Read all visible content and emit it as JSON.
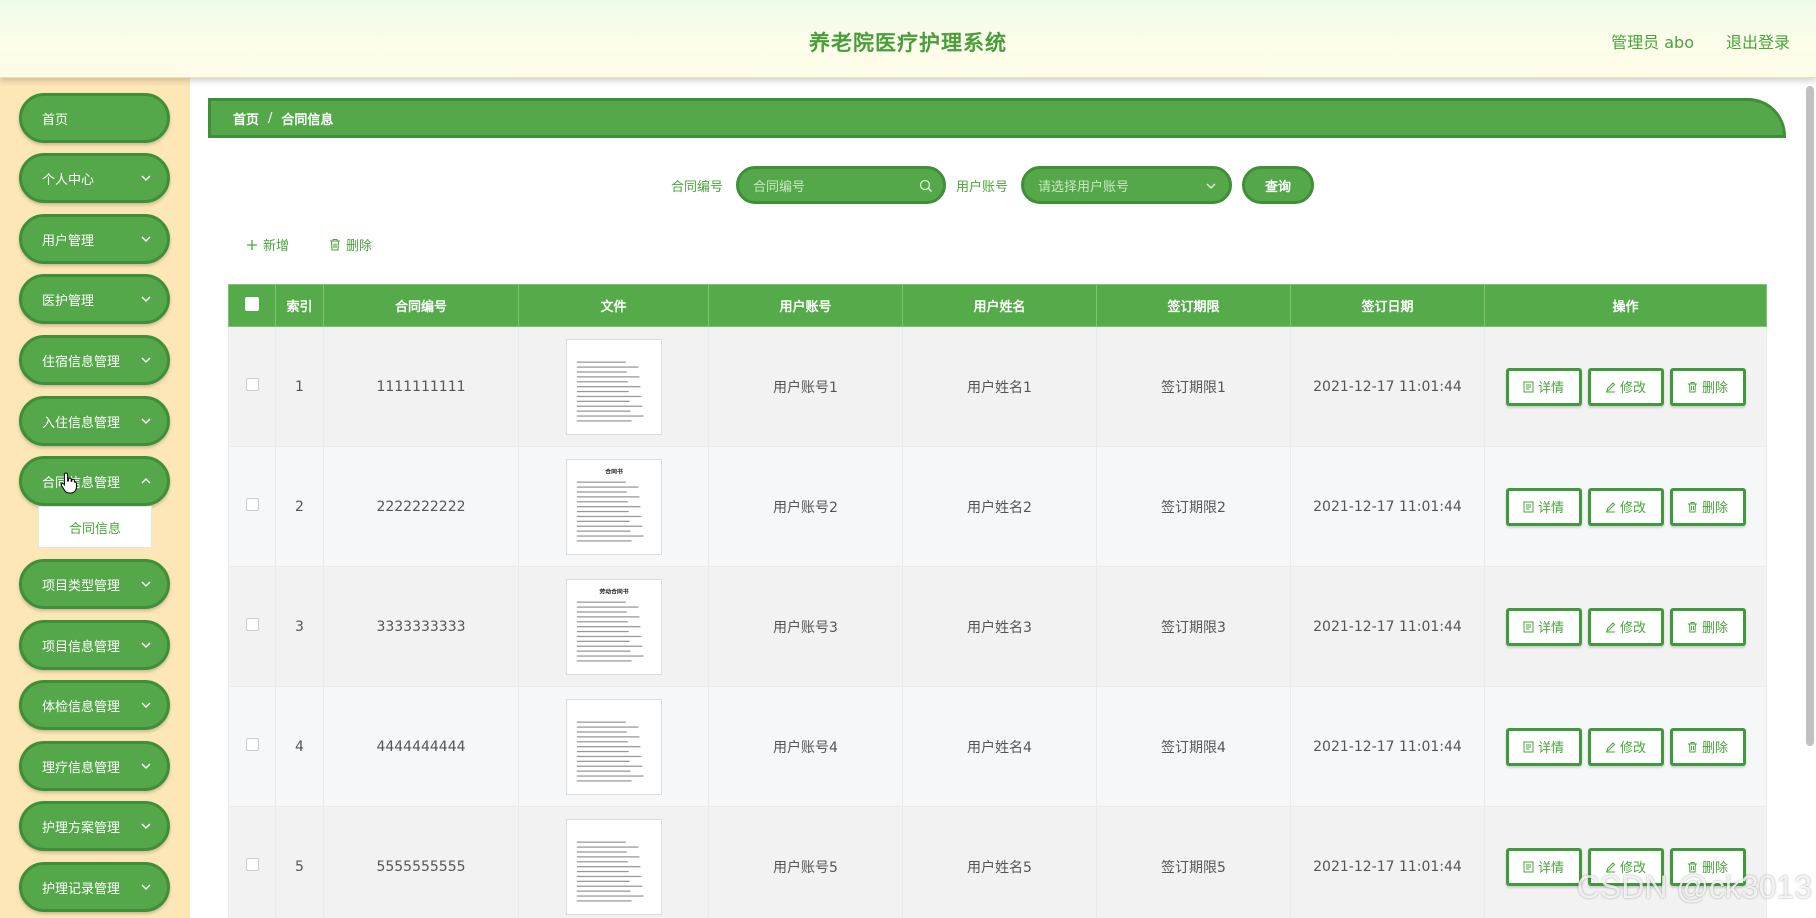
{
  "header": {
    "title": "养老院医疗护理系统",
    "user": "管理员 abo",
    "logout": "退出登录"
  },
  "sidebar": {
    "items": [
      {
        "label": "首页"
      },
      {
        "label": "个人中心"
      },
      {
        "label": "用户管理"
      },
      {
        "label": "医护管理"
      },
      {
        "label": "住宿信息管理"
      },
      {
        "label": "入住信息管理"
      },
      {
        "label": "合同信息管理"
      },
      {
        "label": "项目类型管理"
      },
      {
        "label": "项目信息管理"
      },
      {
        "label": "体检信息管理"
      },
      {
        "label": "理疗信息管理"
      },
      {
        "label": "护理方案管理"
      },
      {
        "label": "护理记录管理"
      }
    ],
    "submenu_label": "合同信息"
  },
  "breadcrumb": {
    "home": "首页",
    "separator": "/",
    "current": "合同信息"
  },
  "search": {
    "contract_label": "合同编号",
    "contract_placeholder": "合同编号",
    "account_label": "用户账号",
    "account_placeholder": "请选择用户账号",
    "button": "查询"
  },
  "toolbar": {
    "add": "新增",
    "delete": "删除"
  },
  "table": {
    "headers": {
      "index": "索引",
      "contract_no": "合同编号",
      "file": "文件",
      "account": "用户账号",
      "name": "用户姓名",
      "term": "签订期限",
      "date": "签订日期",
      "ops": "操作"
    },
    "rows": [
      {
        "index": "1",
        "contract_no": "1111111111",
        "account": "用户账号1",
        "name": "用户姓名1",
        "term": "签订期限1",
        "date": "2021-12-17 11:01:44",
        "doc_title": ""
      },
      {
        "index": "2",
        "contract_no": "2222222222",
        "account": "用户账号2",
        "name": "用户姓名2",
        "term": "签订期限2",
        "date": "2021-12-17 11:01:44",
        "doc_title": "合同书"
      },
      {
        "index": "3",
        "contract_no": "3333333333",
        "account": "用户账号3",
        "name": "用户姓名3",
        "term": "签订期限3",
        "date": "2021-12-17 11:01:44",
        "doc_title": "劳动合同书"
      },
      {
        "index": "4",
        "contract_no": "4444444444",
        "account": "用户账号4",
        "name": "用户姓名4",
        "term": "签订期限4",
        "date": "2021-12-17 11:01:44",
        "doc_title": ""
      },
      {
        "index": "5",
        "contract_no": "5555555555",
        "account": "用户账号5",
        "name": "用户姓名5",
        "term": "签订期限5",
        "date": "2021-12-17 11:01:44",
        "doc_title": ""
      }
    ],
    "actions": {
      "detail": "详情",
      "edit": "修改",
      "delete": "删除"
    }
  },
  "watermark": "CSDN @ck3013",
  "colors": {
    "primary": "#54a84a",
    "primary_border": "#3f8f38",
    "text_green": "#4aa43b",
    "sidebar_bg": "#fde7b6"
  }
}
